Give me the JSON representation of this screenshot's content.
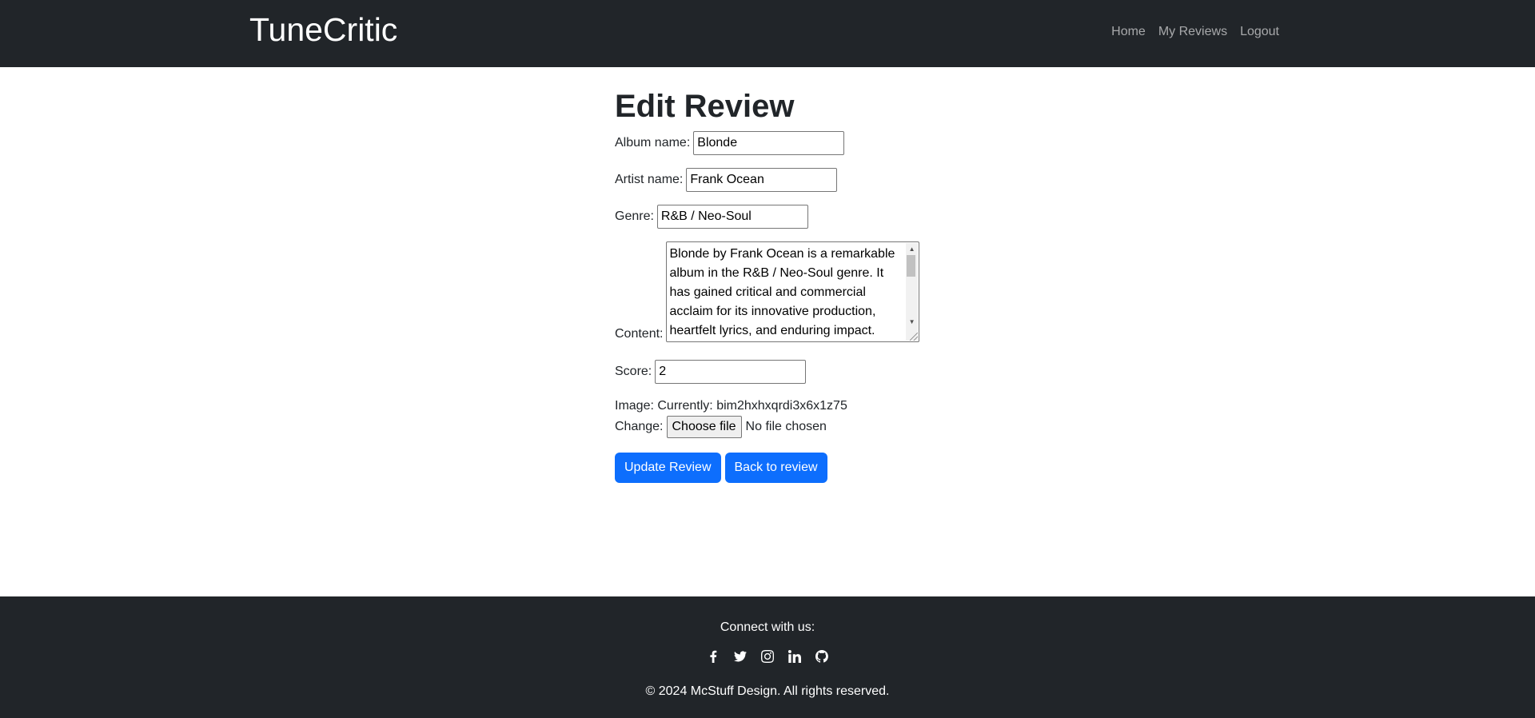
{
  "navbar": {
    "brand": "TuneCritic",
    "links": [
      "Home",
      "My Reviews",
      "Logout"
    ]
  },
  "main": {
    "title": "Edit Review",
    "album": {
      "label": "Album name:",
      "value": "Blonde"
    },
    "artist": {
      "label": "Artist name:",
      "value": "Frank Ocean"
    },
    "genre": {
      "label": "Genre:",
      "value": "R&B / Neo-Soul"
    },
    "content": {
      "label": "Content:",
      "value": "Blonde by Frank Ocean is a remarkable album in the R&B / Neo-Soul genre. It has gained critical and commercial acclaim for its innovative production, heartfelt lyrics, and enduring impact. This"
    },
    "score": {
      "label": "Score:",
      "value": "2"
    },
    "image": {
      "label": "Image:",
      "currently_label": "Currently:",
      "current_file": "bim2hxhxqrdi3x6x1z75",
      "change_label": "Change:",
      "choose_button": "Choose file",
      "status": "No file chosen"
    },
    "buttons": {
      "update": "Update Review",
      "back": "Back to review"
    }
  },
  "footer": {
    "connect": "Connect with us:",
    "socials": [
      "facebook-icon",
      "twitter-icon",
      "instagram-icon",
      "linkedin-icon",
      "github-icon"
    ],
    "copyright": "© 2024 McStuff Design. All rights reserved."
  },
  "colors": {
    "navbar_bg": "#212529",
    "primary": "#0d6efd",
    "text": "#212529"
  }
}
